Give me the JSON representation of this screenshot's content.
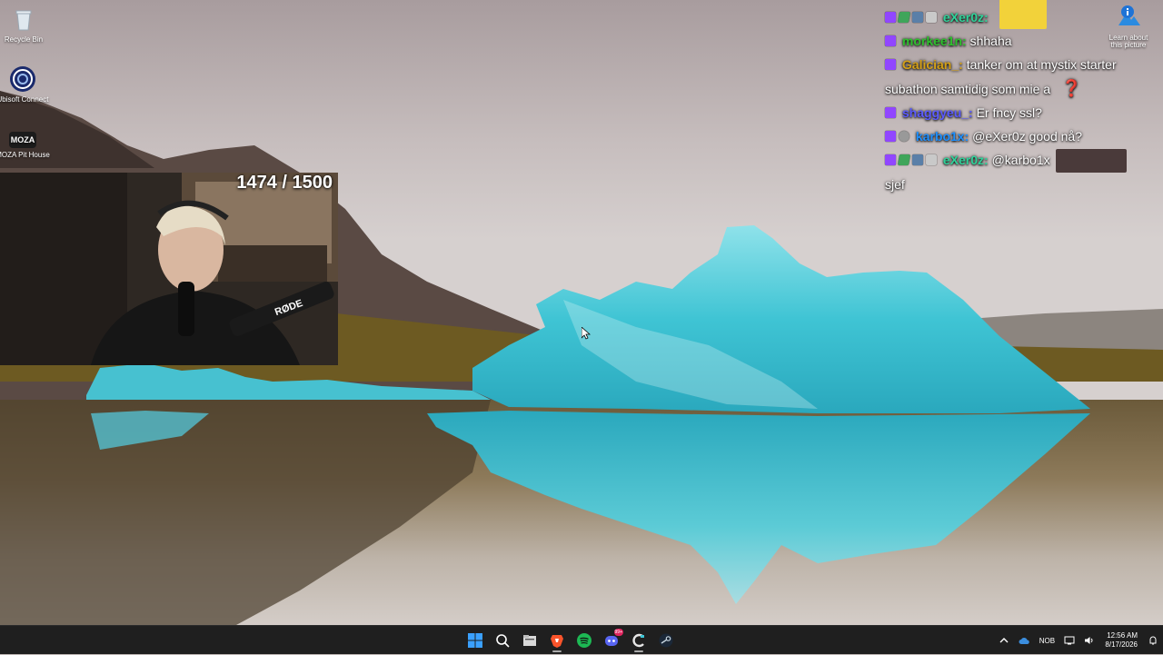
{
  "desktop": {
    "icons": [
      {
        "label": "Recycle Bin",
        "icon": "recycle-bin-icon"
      },
      {
        "label": "Ubisoft Connect",
        "icon": "ubisoft-connect-icon"
      },
      {
        "label": "MOZA Pit House",
        "icon": "moza-pit-house-icon",
        "glyph_text": "MOZA"
      }
    ],
    "learn_icon": {
      "label": "Learn about this picture",
      "icon": "info-icon"
    }
  },
  "webcam": {
    "counter": "1474 / 1500",
    "mic_brand": "RØDE"
  },
  "chat": {
    "messages": [
      {
        "user": "eXer0z:",
        "user_color": "#2fd39a",
        "text": "",
        "badges": [
          "twitch",
          "shield",
          "sub",
          "gift"
        ],
        "emote": "emote-minion"
      },
      {
        "user": "morkee1n:",
        "user_color": "#2ec12e",
        "text": "shhaha",
        "badges": [
          "twitch"
        ]
      },
      {
        "user": "Galician_:",
        "user_color": "#d4a017",
        "text": "tanker om at mystix starter subathon samtidig som mie a",
        "badges": [
          "twitch"
        ],
        "emote": "question-emote"
      },
      {
        "user": "shaggyeu_:",
        "user_color": "#5b5bff",
        "text": "Er fncy ssl?",
        "badges": [
          "twitch"
        ]
      },
      {
        "user": "karbo1x:",
        "user_color": "#1e90ff",
        "text": "@eXer0z good nå?",
        "badges": [
          "twitch",
          "bits"
        ]
      },
      {
        "user": "eXer0z:",
        "user_color": "#2fd39a",
        "text": "@karbo1x",
        "text2": "sjef",
        "badges": [
          "twitch",
          "shield",
          "sub",
          "gift"
        ],
        "emote": "emote-screenshot"
      }
    ]
  },
  "taskbar": {
    "apps": [
      {
        "name": "start-button",
        "icon": "windows-icon"
      },
      {
        "name": "search-button",
        "icon": "search-icon"
      },
      {
        "name": "file-explorer-button",
        "icon": "folder-icon"
      },
      {
        "name": "brave-button",
        "icon": "brave-icon",
        "active": true
      },
      {
        "name": "spotify-button",
        "icon": "spotify-icon"
      },
      {
        "name": "discord-button",
        "icon": "discord-icon",
        "badge": "99+"
      },
      {
        "name": "ccleaner-button",
        "icon": "ccleaner-icon",
        "active": true
      },
      {
        "name": "steam-button",
        "icon": "steam-icon"
      }
    ],
    "tray": {
      "language": "NOB",
      "time": "12:56 AM",
      "date": "8/17/2026"
    }
  },
  "colors": {
    "taskbar_bg": "#1f1f1f",
    "twitch_badge": "#9146ff",
    "iceberg": "#3ec6d6"
  }
}
